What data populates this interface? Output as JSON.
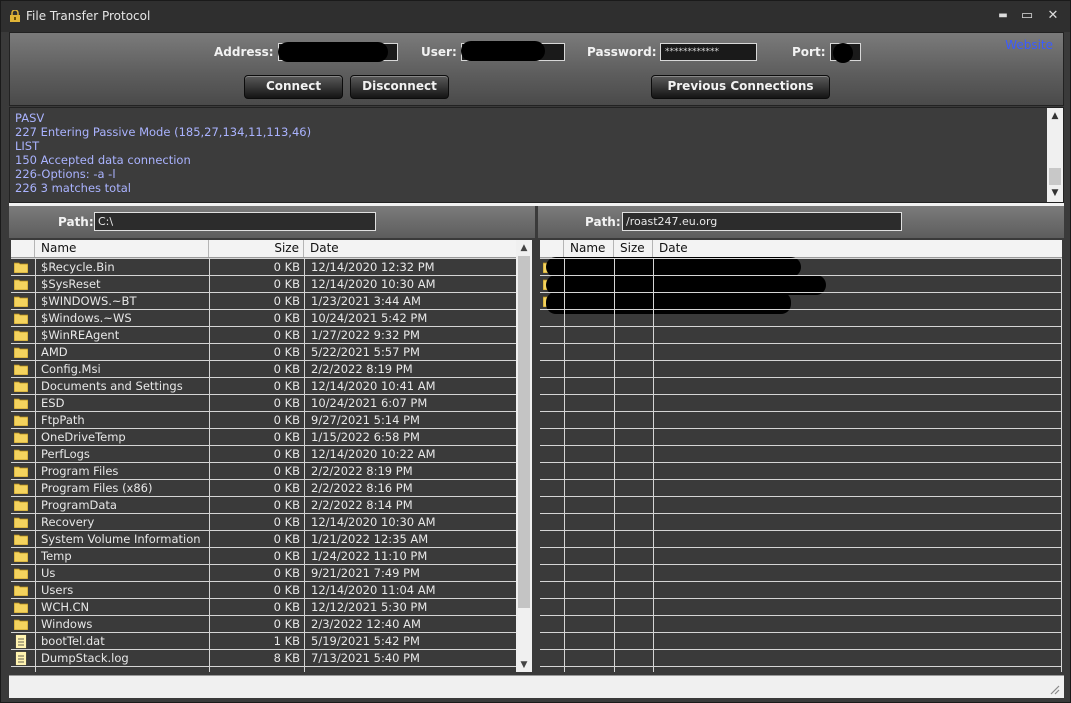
{
  "window": {
    "title": "File Transfer Protocol",
    "min": "▬",
    "max": "▭",
    "close": "✕",
    "icon": "lock-folder-icon"
  },
  "connection": {
    "address_label": "Address:",
    "user_label": "User:",
    "password_label": "Password:",
    "password_value": "************",
    "port_label": "Port:",
    "connect": "Connect",
    "disconnect": "Disconnect",
    "previous": "Previous Connections",
    "website": "Website"
  },
  "log": [
    "PASV",
    "227 Entering Passive Mode (185,27,134,11,113,46)",
    "LIST",
    "150 Accepted data connection",
    "226-Options: -a -l",
    "226 3 matches total"
  ],
  "local": {
    "path_label": "Path:",
    "path": "C:\\",
    "columns": {
      "name": "Name",
      "size": "Size",
      "date": "Date"
    },
    "files": [
      {
        "name": "$Recycle.Bin",
        "size": "0 KB",
        "date": "12/14/2020 12:32 PM",
        "type": "folder"
      },
      {
        "name": "$SysReset",
        "size": "0 KB",
        "date": "12/14/2020 10:30 AM",
        "type": "folder"
      },
      {
        "name": "$WINDOWS.~BT",
        "size": "0 KB",
        "date": "1/23/2021 3:44 AM",
        "type": "folder"
      },
      {
        "name": "$Windows.~WS",
        "size": "0 KB",
        "date": "10/24/2021 5:42 PM",
        "type": "folder"
      },
      {
        "name": "$WinREAgent",
        "size": "0 KB",
        "date": "1/27/2022 9:32 PM",
        "type": "folder"
      },
      {
        "name": "AMD",
        "size": "0 KB",
        "date": "5/22/2021 5:57 PM",
        "type": "folder"
      },
      {
        "name": "Config.Msi",
        "size": "0 KB",
        "date": "2/2/2022 8:19 PM",
        "type": "folder"
      },
      {
        "name": "Documents and Settings",
        "size": "0 KB",
        "date": "12/14/2020 10:41 AM",
        "type": "folder"
      },
      {
        "name": "ESD",
        "size": "0 KB",
        "date": "10/24/2021 6:07 PM",
        "type": "folder"
      },
      {
        "name": "FtpPath",
        "size": "0 KB",
        "date": "9/27/2021 5:14 PM",
        "type": "folder"
      },
      {
        "name": "OneDriveTemp",
        "size": "0 KB",
        "date": "1/15/2022 6:58 PM",
        "type": "folder"
      },
      {
        "name": "PerfLogs",
        "size": "0 KB",
        "date": "12/14/2020 10:22 AM",
        "type": "folder"
      },
      {
        "name": "Program Files",
        "size": "0 KB",
        "date": "2/2/2022 8:19 PM",
        "type": "folder"
      },
      {
        "name": "Program Files (x86)",
        "size": "0 KB",
        "date": "2/2/2022 8:16 PM",
        "type": "folder"
      },
      {
        "name": "ProgramData",
        "size": "0 KB",
        "date": "2/2/2022 8:14 PM",
        "type": "folder"
      },
      {
        "name": "Recovery",
        "size": "0 KB",
        "date": "12/14/2020 10:30 AM",
        "type": "folder"
      },
      {
        "name": "System Volume Information",
        "size": "0 KB",
        "date": "1/21/2022 12:35 AM",
        "type": "folder"
      },
      {
        "name": "Temp",
        "size": "0 KB",
        "date": "1/24/2022 11:10 PM",
        "type": "folder"
      },
      {
        "name": "Us",
        "size": "0 KB",
        "date": "9/21/2021 7:49 PM",
        "type": "folder"
      },
      {
        "name": "Users",
        "size": "0 KB",
        "date": "12/14/2020 11:04 AM",
        "type": "folder"
      },
      {
        "name": "WCH.CN",
        "size": "0 KB",
        "date": "12/12/2021 5:30 PM",
        "type": "folder"
      },
      {
        "name": "Windows",
        "size": "0 KB",
        "date": "2/3/2022 12:40 AM",
        "type": "folder"
      },
      {
        "name": "bootTel.dat",
        "size": "1 KB",
        "date": "5/19/2021 5:42 PM",
        "type": "file"
      },
      {
        "name": "DumpStack.log",
        "size": "8 KB",
        "date": "7/13/2021 5:40 PM",
        "type": "file"
      }
    ]
  },
  "remote": {
    "path_label": "Path:",
    "path": "/roast247.eu.org",
    "columns": {
      "name": "Name",
      "size": "Size",
      "date": "Date"
    },
    "files": [
      {
        "redacted": true
      },
      {
        "redacted": true
      },
      {
        "redacted": true
      }
    ]
  },
  "colors": {
    "log_text": "#aab3ff",
    "website_link": "#3b5bff",
    "panel_bg": "#3a3a3a"
  }
}
